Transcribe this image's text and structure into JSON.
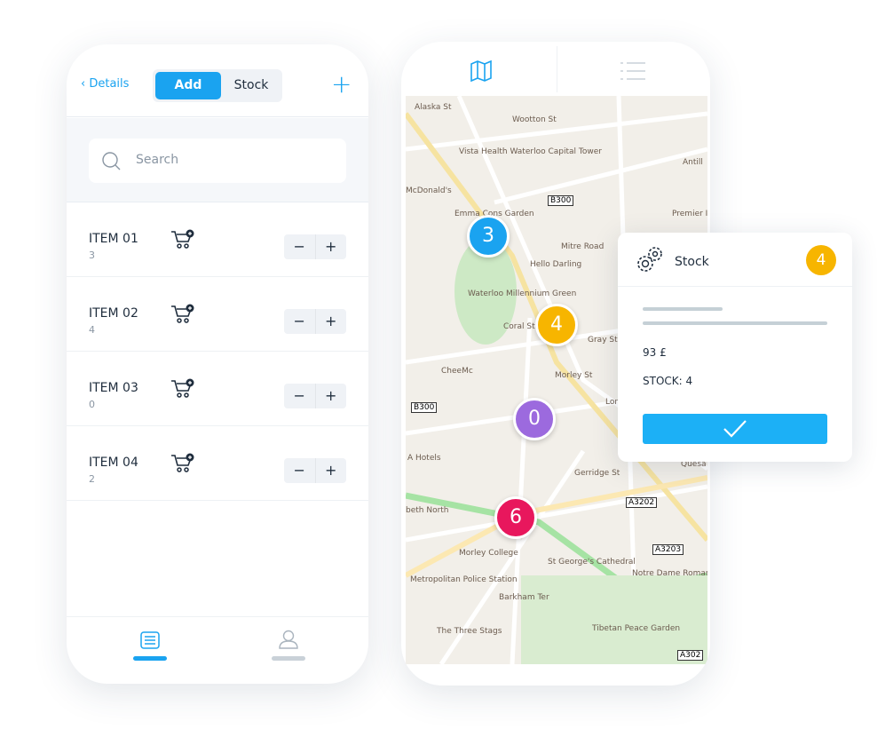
{
  "left": {
    "back": "Details",
    "tabs": [
      "Add",
      "Stock"
    ],
    "add_icon": "plus-icon",
    "search_placeholder": "Search",
    "items": [
      {
        "name": "ITEM 01",
        "qty": "3"
      },
      {
        "name": "ITEM 02",
        "qty": "4"
      },
      {
        "name": "ITEM 03",
        "qty": "0"
      },
      {
        "name": "ITEM 04",
        "qty": "2"
      }
    ],
    "stepper": {
      "minus": "−",
      "plus": "+"
    },
    "nav": [
      "list-icon",
      "user-icon"
    ]
  },
  "right": {
    "tabs": [
      "map-icon",
      "list-icon"
    ],
    "markers": [
      {
        "label": "3",
        "color": "#1aa3f0"
      },
      {
        "label": "4",
        "color": "#f7b500"
      },
      {
        "label": "0",
        "color": "#9c6ade"
      },
      {
        "label": "6",
        "color": "#e8175d"
      }
    ],
    "map_labels": [
      "Alaska St",
      "Wootton St",
      "Vista Health Waterloo Capital Tower",
      "Emma Cons Garden",
      "B300",
      "Mitre Road",
      "Hello Darling",
      "Waterloo Millennium Green",
      "Coral St",
      "Gray St",
      "CheeMc",
      "Morley St",
      "B300",
      "A Hotels",
      "Gerridge St",
      "A3202",
      "Morley College",
      "St George's Cathedral",
      "A3203",
      "Metropolitan Police Station",
      "Notre Dame Roman Catholic Girls' School",
      "Barkham Ter",
      "The Three Stags",
      "Tibetan Peace Garden",
      "A302",
      "Premier Inn",
      "Antill",
      "McDonald's",
      "London Cry",
      "Quesa",
      "beth North"
    ]
  },
  "card": {
    "title": "Stock",
    "badge": "4",
    "badge_color": "#f7b500",
    "price": "93 £",
    "stock": "STOCK: 4",
    "confirm_icon": "check-icon"
  }
}
